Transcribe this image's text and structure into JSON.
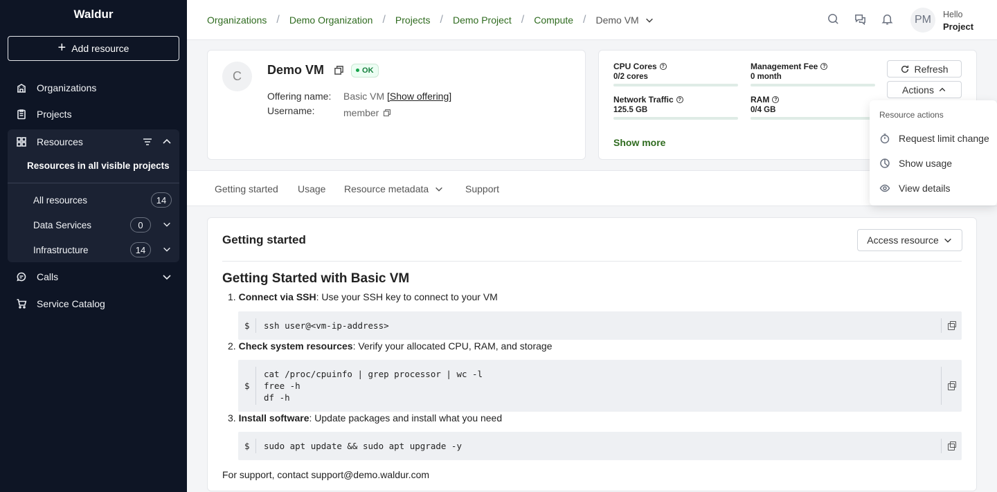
{
  "app": {
    "title": "Waldur"
  },
  "sidebar": {
    "add_resource": "Add resource",
    "organizations": "Organizations",
    "projects": "Projects",
    "resources": "Resources",
    "resources_sub": "Resources in all visible projects",
    "resource_items": [
      {
        "label": "All resources",
        "count": "14"
      },
      {
        "label": "Data Services",
        "count": "0"
      },
      {
        "label": "Infrastructure",
        "count": "14"
      }
    ],
    "calls": "Calls",
    "service_catalog": "Service Catalog"
  },
  "breadcrumbs": [
    "Organizations",
    "Demo Organization",
    "Projects",
    "Demo Project",
    "Compute"
  ],
  "breadcrumb_current": "Demo VM",
  "user": {
    "initials": "PM",
    "greeting": "Hello",
    "name": "Project"
  },
  "resource": {
    "avatar_letter": "C",
    "name": "Demo VM",
    "status": "OK",
    "offering_label": "Offering name:",
    "offering_value": "Basic VM",
    "show_offering": "[Show offering]",
    "username_label": "Username:",
    "username_value": "member"
  },
  "metrics": [
    {
      "label": "CPU Cores",
      "value": "0/2 cores",
      "fraction": 0
    },
    {
      "label": "Management Fee",
      "value": "0 month",
      "fraction": 0
    },
    {
      "label": "Network Traffic",
      "value": "125.5 GB",
      "fraction": 0
    },
    {
      "label": "RAM",
      "value": "0/4 GB",
      "fraction": 0
    }
  ],
  "show_more": "Show more",
  "buttons": {
    "refresh": "Refresh",
    "actions": "Actions",
    "access_resource": "Access resource"
  },
  "actions_menu": {
    "title": "Resource actions",
    "items": [
      "Request limit change",
      "Show usage",
      "View details"
    ]
  },
  "tabs": [
    "Getting started",
    "Usage",
    "Resource metadata",
    "Support"
  ],
  "getting_started": {
    "heading": "Getting started",
    "title": "Getting Started with Basic VM",
    "steps": [
      {
        "num": "1.",
        "bold": "Connect via SSH",
        "text": ": Use your SSH key to connect to your VM",
        "code": "ssh user@<vm-ip-address>"
      },
      {
        "num": "2.",
        "bold": "Check system resources",
        "text": ": Verify your allocated CPU, RAM, and storage",
        "code": "cat /proc/cpuinfo | grep processor | wc -l\nfree -h\ndf -h"
      },
      {
        "num": "3.",
        "bold": "Install software",
        "text": ": Update packages and install what you need",
        "code": "sudo apt update && sudo apt upgrade -y"
      }
    ],
    "prompt": "$",
    "support": "For support, contact support@demo.waldur.com"
  },
  "colors": {
    "sidebar_bg": "#0e1525",
    "accent": "#2f6b1f",
    "ok": "#16a34a"
  },
  "icons": [
    "plus-icon",
    "building-icon",
    "clipboard-icon",
    "grid-icon",
    "filter-icon",
    "chevron-up-icon",
    "chevron-down-icon",
    "chat-icon",
    "cart-icon",
    "search-icon",
    "messages-icon",
    "bell-icon",
    "copy-icon",
    "help-icon",
    "refresh-icon",
    "timer-icon",
    "pie-chart-icon",
    "eye-icon"
  ]
}
